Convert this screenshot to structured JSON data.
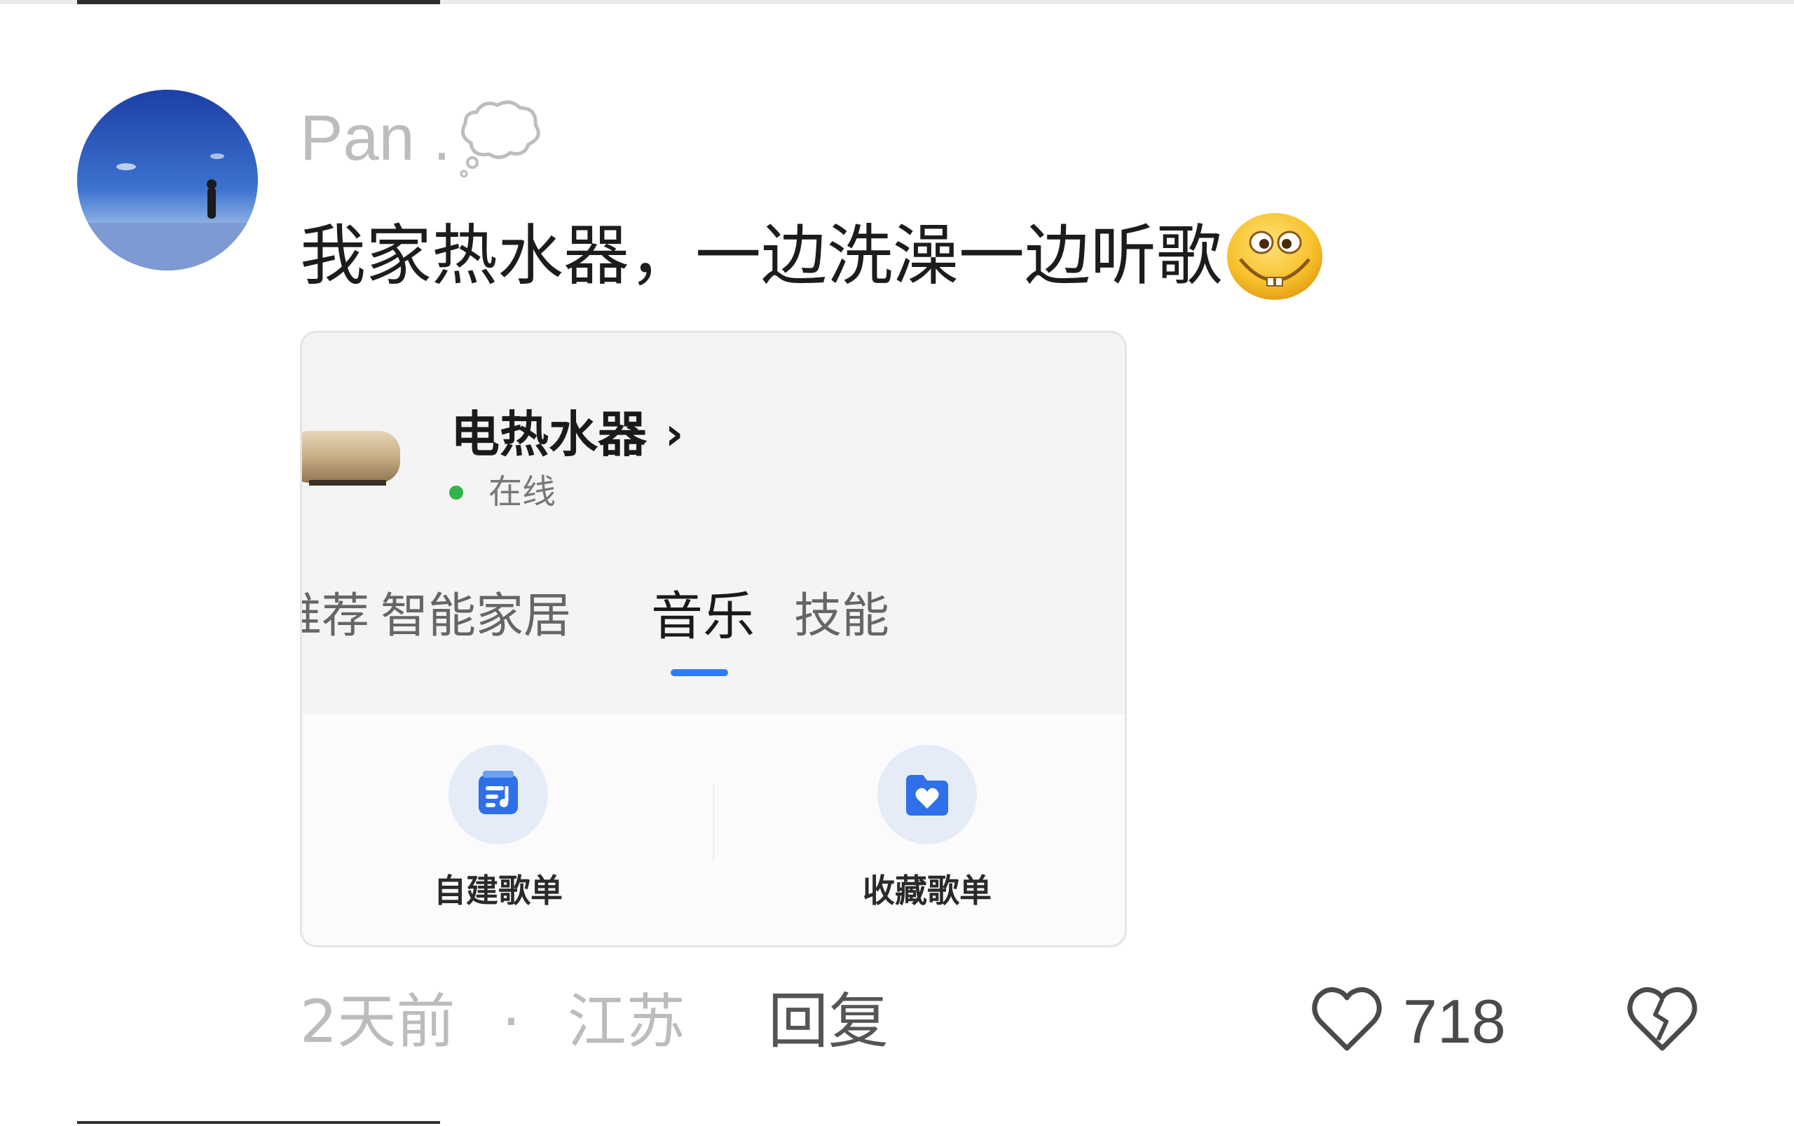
{
  "comment": {
    "username": "Pan",
    "username_dot": ".",
    "text": "我家热水器，一边洗澡一边听歌",
    "time": "2天前",
    "separator": "·",
    "location": "江苏",
    "reply_label": "回复",
    "like_count": "718"
  },
  "card": {
    "device_name": "电热水器",
    "chevron": "›",
    "status": "在线",
    "tabs": [
      {
        "label": "推荐"
      },
      {
        "label": "智能家居"
      },
      {
        "label": "音乐"
      },
      {
        "label": "技能"
      }
    ],
    "active_tab": "音乐",
    "features": [
      {
        "label": "自建歌单",
        "icon": "playlist-icon"
      },
      {
        "label": "收藏歌单",
        "icon": "favorite-folder-icon"
      }
    ]
  },
  "colors": {
    "accent": "#2f7df6",
    "online": "#33b44a",
    "muted": "#bdbdbd"
  }
}
